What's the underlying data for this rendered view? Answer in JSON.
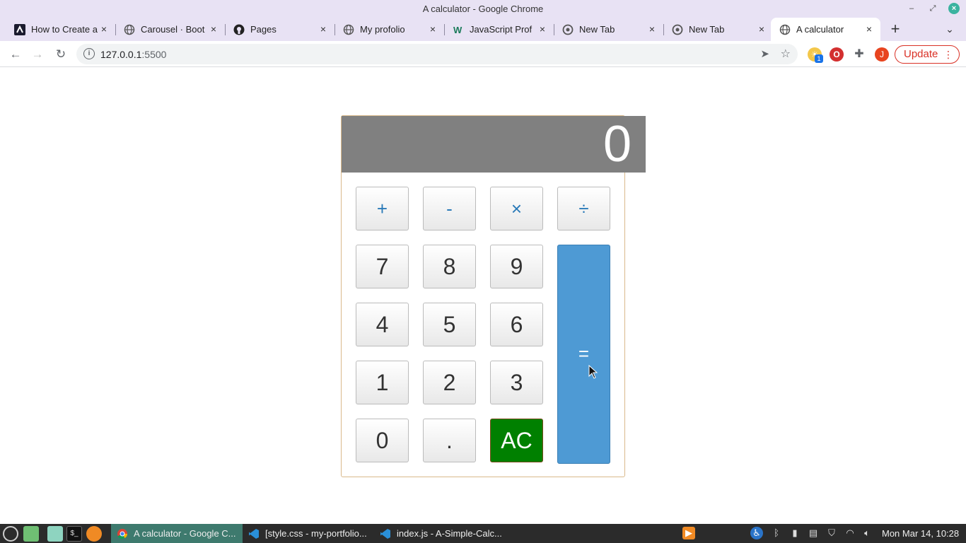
{
  "window": {
    "title": "A calculator - Google Chrome"
  },
  "tabs": [
    {
      "label": "How to Create a",
      "icon": "aha-logo-icon"
    },
    {
      "label": "Carousel · Boot",
      "icon": "globe-icon"
    },
    {
      "label": "Pages",
      "icon": "github-icon"
    },
    {
      "label": "My profolio",
      "icon": "globe-icon"
    },
    {
      "label": "JavaScript Prof",
      "icon": "w-logo-icon"
    },
    {
      "label": "New Tab",
      "icon": "chrome-icon"
    },
    {
      "label": "New Tab",
      "icon": "chrome-icon"
    },
    {
      "label": "A calculator",
      "icon": "globe-icon",
      "active": true
    }
  ],
  "address": {
    "host": "127.0.0.1",
    "port": ":5500"
  },
  "toolbar": {
    "update_label": "Update",
    "profile_initial": "J",
    "ext_badge": "1"
  },
  "calculator": {
    "display": "0",
    "keys": {
      "plus": "+",
      "minus": "-",
      "times": "×",
      "divide": "÷",
      "k7": "7",
      "k8": "8",
      "k9": "9",
      "k4": "4",
      "k5": "5",
      "k6": "6",
      "k1": "1",
      "k2": "2",
      "k3": "3",
      "k0": "0",
      "dot": ".",
      "ac": "AC",
      "equals": "="
    },
    "colors": {
      "display_bg": "#808080",
      "ac_bg": "#008000",
      "equals_bg": "#4e9ad4",
      "operator_text": "#2a7ab8"
    }
  },
  "taskbar": {
    "tasks": [
      {
        "label": "A calculator - Google C...",
        "active": true
      },
      {
        "label": "[style.css - my-portfolio..."
      },
      {
        "label": "index.js - A-Simple-Calc..."
      }
    ],
    "clock": "Mon Mar 14, 10:28"
  }
}
